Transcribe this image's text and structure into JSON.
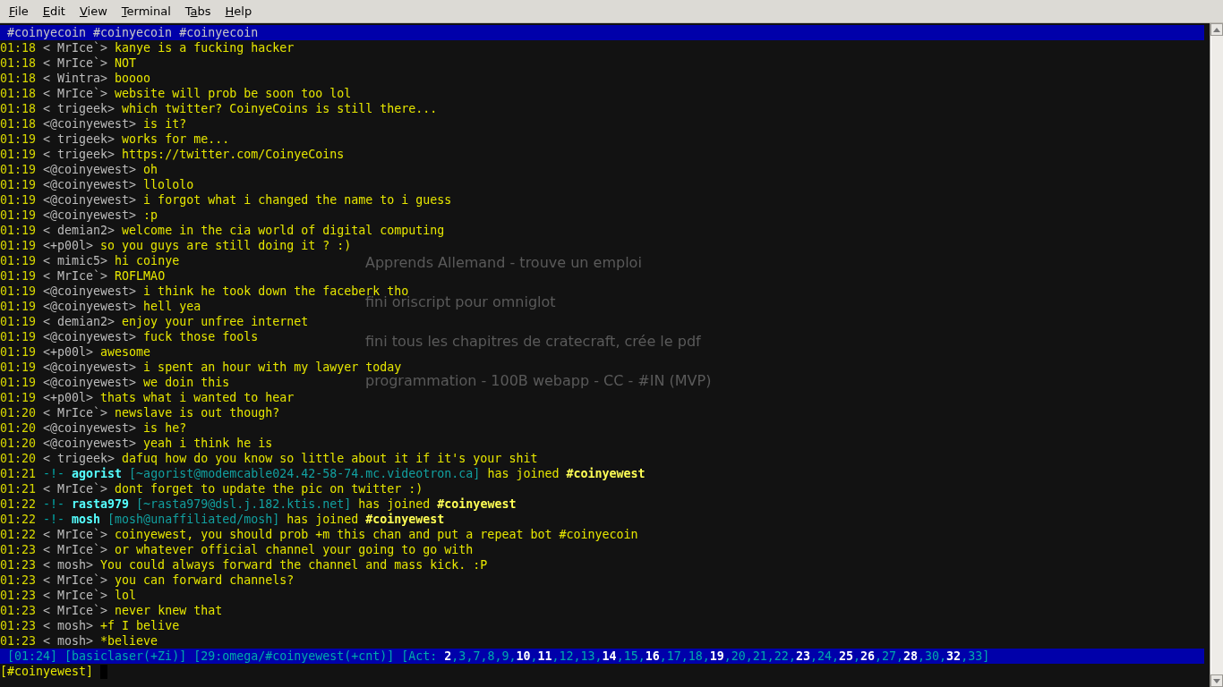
{
  "menu": [
    {
      "mnemonic": "F",
      "rest": "ile"
    },
    {
      "mnemonic": "E",
      "rest": "dit"
    },
    {
      "mnemonic": "V",
      "rest": "iew"
    },
    {
      "mnemonic": "T",
      "rest": "erminal"
    },
    {
      "before": "T",
      "mnemonic": "a",
      "rest": "bs"
    },
    {
      "mnemonic": "H",
      "rest": "elp"
    }
  ],
  "topic": "#coinyecoin #coinyecoin #coinyecoin",
  "desktop_notes": [
    "Apprends Allemand - trouve un emploi",
    "fini oriscript pour omniglot",
    "fini tous les chapitres de cratecraft, crée le pdf",
    "programmation - 100B webapp - CC - #IN (MVP)"
  ],
  "lines": [
    {
      "kind": "msg",
      "time": "01:18",
      "nick": "< MrIce`>",
      "text": "kanye is a fucking hacker"
    },
    {
      "kind": "msg",
      "time": "01:18",
      "nick": "< MrIce`>",
      "text": "NOT"
    },
    {
      "kind": "msg",
      "time": "01:18",
      "nick": "< Wintra>",
      "text": "boooo"
    },
    {
      "kind": "msg",
      "time": "01:18",
      "nick": "< MrIce`>",
      "text": "website will prob be soon too lol"
    },
    {
      "kind": "msg",
      "time": "01:18",
      "nick": "< trigeek>",
      "text": "which twitter? CoinyeCoins is still there..."
    },
    {
      "kind": "msg",
      "time": "01:18",
      "nick": "<@coinyewest>",
      "text": "is it?"
    },
    {
      "kind": "msg",
      "time": "01:19",
      "nick": "< trigeek>",
      "text": "works for me..."
    },
    {
      "kind": "msg",
      "time": "01:19",
      "nick": "< trigeek>",
      "text": "https://twitter.com/CoinyeCoins"
    },
    {
      "kind": "msg",
      "time": "01:19",
      "nick": "<@coinyewest>",
      "text": "oh"
    },
    {
      "kind": "msg",
      "time": "01:19",
      "nick": "<@coinyewest>",
      "text": "llololo"
    },
    {
      "kind": "msg",
      "time": "01:19",
      "nick": "<@coinyewest>",
      "text": "i forgot what i changed the name to i guess"
    },
    {
      "kind": "msg",
      "time": "01:19",
      "nick": "<@coinyewest>",
      "text": ":p"
    },
    {
      "kind": "msg",
      "time": "01:19",
      "nick": "< demian2>",
      "text": "welcome in the cia world of digital computing"
    },
    {
      "kind": "msg",
      "time": "01:19",
      "nick": "<+p00l>",
      "text": "so you guys are still doing it ? :)"
    },
    {
      "kind": "msg",
      "time": "01:19",
      "nick": "< mimic5>",
      "text": "hi coinye"
    },
    {
      "kind": "msg",
      "time": "01:19",
      "nick": "< MrIce`>",
      "text": "ROFLMAO"
    },
    {
      "kind": "msg",
      "time": "01:19",
      "nick": "<@coinyewest>",
      "text": "i think he took down the faceberk tho"
    },
    {
      "kind": "msg",
      "time": "01:19",
      "nick": "<@coinyewest>",
      "text": "hell yea"
    },
    {
      "kind": "msg",
      "time": "01:19",
      "nick": "< demian2>",
      "text": "enjoy your unfree internet"
    },
    {
      "kind": "msg",
      "time": "01:19",
      "nick": "<@coinyewest>",
      "text": "fuck those fools"
    },
    {
      "kind": "msg",
      "time": "01:19",
      "nick": "<+p00l>",
      "text": "awesome"
    },
    {
      "kind": "msg",
      "time": "01:19",
      "nick": "<@coinyewest>",
      "text": "i spent an hour with my lawyer today"
    },
    {
      "kind": "msg",
      "time": "01:19",
      "nick": "<@coinyewest>",
      "text": "we doin this"
    },
    {
      "kind": "msg",
      "time": "01:19",
      "nick": "<+p00l>",
      "text": "thats what i wanted to hear"
    },
    {
      "kind": "msg",
      "time": "01:20",
      "nick": "< MrIce`>",
      "text": "newslave is out though?"
    },
    {
      "kind": "msg",
      "time": "01:20",
      "nick": "<@coinyewest>",
      "text": "is he?"
    },
    {
      "kind": "msg",
      "time": "01:20",
      "nick": "<@coinyewest>",
      "text": "yeah i think he is"
    },
    {
      "kind": "msg",
      "time": "01:20",
      "nick": "< trigeek>",
      "text": "dafuq how do you know so little about it if it's your shit"
    },
    {
      "kind": "join",
      "time": "01:21",
      "marker": "-!-",
      "nick": "agorist",
      "host": "[~agorist@modemcable024.42-58-74.mc.videotron.ca]",
      "text": "has joined",
      "channel": "#coinyewest"
    },
    {
      "kind": "msg",
      "time": "01:21",
      "nick": "< MrIce`>",
      "text": "dont forget to update the pic on twitter :)"
    },
    {
      "kind": "join",
      "time": "01:22",
      "marker": "-!-",
      "nick": "rasta979",
      "host": "[~rasta979@dsl.j.182.ktis.net]",
      "text": "has joined",
      "channel": "#coinyewest"
    },
    {
      "kind": "join",
      "time": "01:22",
      "marker": "-!-",
      "nick": "mosh",
      "host": "[mosh@unaffiliated/mosh]",
      "text": "has joined",
      "channel": "#coinyewest"
    },
    {
      "kind": "msg",
      "time": "01:22",
      "nick": "< MrIce`>",
      "text": "coinyewest, you should prob +m this chan and put a repeat bot #coinyecoin"
    },
    {
      "kind": "msg",
      "time": "01:23",
      "nick": "< MrIce`>",
      "text": "or whatever official channel your going to go with"
    },
    {
      "kind": "msg",
      "time": "01:23",
      "nick": "< mosh>",
      "text": "You could always forward the channel and mass kick. :P"
    },
    {
      "kind": "msg",
      "time": "01:23",
      "nick": "< MrIce`>",
      "text": "you can forward channels?"
    },
    {
      "kind": "msg",
      "time": "01:23",
      "nick": "< MrIce`>",
      "text": "lol"
    },
    {
      "kind": "msg",
      "time": "01:23",
      "nick": "< MrIce`>",
      "text": "never knew that"
    },
    {
      "kind": "msg",
      "time": "01:23",
      "nick": "< mosh>",
      "text": "+f I belive"
    },
    {
      "kind": "msg",
      "time": "01:23",
      "nick": "< mosh>",
      "text": "*believe"
    }
  ],
  "status": {
    "segments": [
      "[01:24]",
      "[basiclaser(+Zi)]",
      "[29:omega/#coinyewest(+cnt)]"
    ],
    "act_label": "[Act:",
    "act_close": "]",
    "activity": [
      {
        "number": "2",
        "separator": ",",
        "highlight": true
      },
      {
        "number": "3",
        "separator": ",",
        "highlight": false
      },
      {
        "number": "7",
        "separator": ",",
        "highlight": false
      },
      {
        "number": "8",
        "separator": ",",
        "highlight": false
      },
      {
        "number": "9",
        "separator": ",",
        "highlight": false
      },
      {
        "number": "10",
        "separator": ",",
        "highlight": true
      },
      {
        "number": "11",
        "separator": ",",
        "highlight": true
      },
      {
        "number": "12",
        "separator": ",",
        "highlight": false
      },
      {
        "number": "13",
        "separator": ",",
        "highlight": false
      },
      {
        "number": "14",
        "separator": ",",
        "highlight": true
      },
      {
        "number": "15",
        "separator": ",",
        "highlight": false
      },
      {
        "number": "16",
        "separator": ",",
        "highlight": true
      },
      {
        "number": "17",
        "separator": ",",
        "highlight": false
      },
      {
        "number": "18",
        "separator": ",",
        "highlight": false
      },
      {
        "number": "19",
        "separator": ",",
        "highlight": true
      },
      {
        "number": "20",
        "separator": ",",
        "highlight": false
      },
      {
        "number": "21",
        "separator": ",",
        "highlight": false
      },
      {
        "number": "22",
        "separator": ",",
        "highlight": false
      },
      {
        "number": "23",
        "separator": ",",
        "highlight": true
      },
      {
        "number": "24",
        "separator": ",",
        "highlight": false
      },
      {
        "number": "25",
        "separator": ",",
        "highlight": true
      },
      {
        "number": "26",
        "separator": ",",
        "highlight": true
      },
      {
        "number": "27",
        "separator": ",",
        "highlight": false
      },
      {
        "number": "28",
        "separator": ",",
        "highlight": true
      },
      {
        "number": "30",
        "separator": ",",
        "highlight": false
      },
      {
        "number": "32",
        "separator": ",",
        "highlight": true
      },
      {
        "number": "33",
        "highlight": false
      }
    ]
  },
  "prompt": "[#coinyewest]"
}
